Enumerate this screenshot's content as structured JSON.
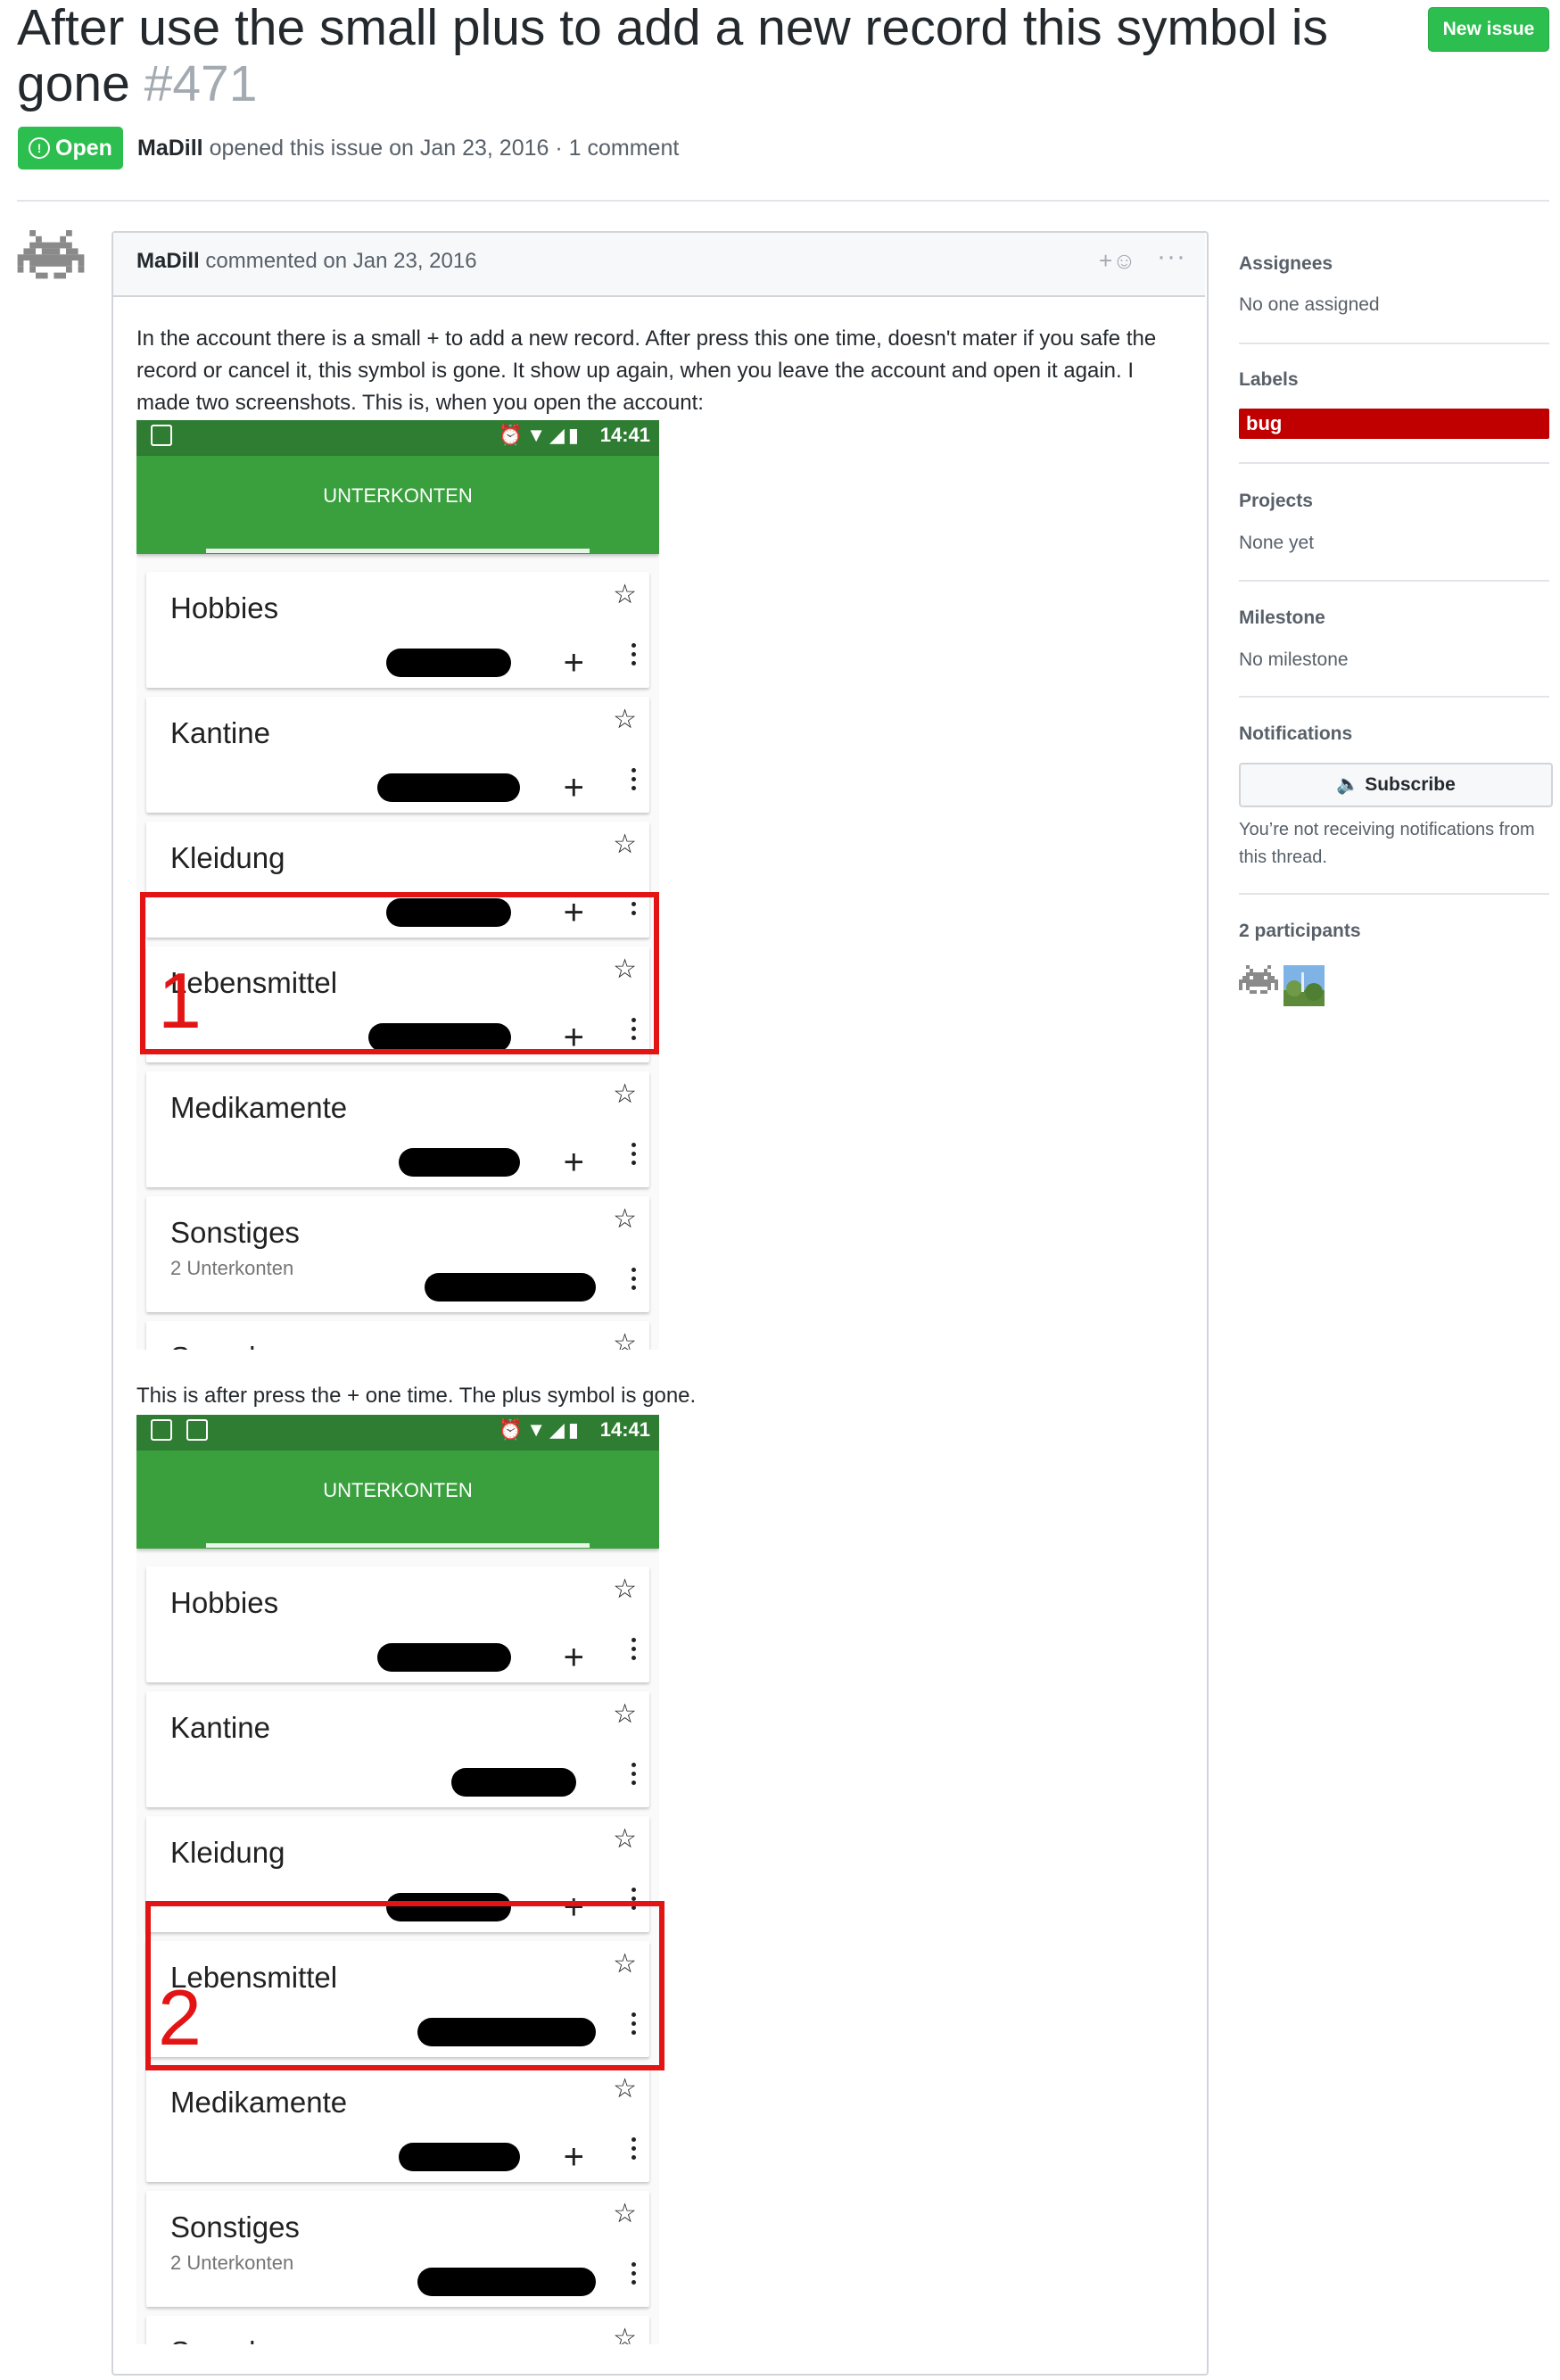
{
  "issue": {
    "title": "After use the small plus to add a new record this symbol is gone",
    "number": "#471",
    "state": "Open",
    "author": "MaDill",
    "opened_text": "opened this issue on Jan 23, 2016 · 1 comment",
    "new_issue_label": "New issue"
  },
  "comment": {
    "author": "MaDill",
    "commented_text": "commented on Jan 23, 2016",
    "react_label": "+☺",
    "more_label": "···",
    "paragraph1": "In the account there is a small + to add a new record. After press this one time, doesn't mater if you safe the record or cancel it, this symbol is gone. It show up again, when you leave the account and open it again. I made two screenshots. This is, when you open the account:",
    "paragraph2": "This is after press the + one time. The plus symbol is gone."
  },
  "screenshots": [
    {
      "time": "14:41",
      "tab_label": "UNTERKONTEN",
      "marker": "1",
      "items": [
        {
          "name": "Hobbies",
          "sub": "",
          "plus": true
        },
        {
          "name": "Kantine",
          "sub": "",
          "plus": true
        },
        {
          "name": "Kleidung",
          "sub": "",
          "plus": true
        },
        {
          "name": "Lebensmittel",
          "sub": "",
          "plus": true
        },
        {
          "name": "Medikamente",
          "sub": "",
          "plus": true
        },
        {
          "name": "Sonstiges",
          "sub": "2 Unterkonten",
          "plus": false
        },
        {
          "name": "Spenden",
          "sub": "",
          "plus": false
        }
      ]
    },
    {
      "time": "14:41",
      "tab_label": "UNTERKONTEN",
      "marker": "2",
      "items": [
        {
          "name": "Hobbies",
          "sub": "",
          "plus": true
        },
        {
          "name": "Kantine",
          "sub": "",
          "plus": false
        },
        {
          "name": "Kleidung",
          "sub": "",
          "plus": true
        },
        {
          "name": "Lebensmittel",
          "sub": "",
          "plus": false
        },
        {
          "name": "Medikamente",
          "sub": "",
          "plus": true
        },
        {
          "name": "Sonstiges",
          "sub": "2 Unterkonten",
          "plus": false
        },
        {
          "name": "Spenden",
          "sub": "",
          "plus": false
        }
      ]
    }
  ],
  "sidebar": {
    "assignees_label": "Assignees",
    "assignees_value": "No one assigned",
    "labels_label": "Labels",
    "label_bug": "bug",
    "label_bug_color": "#c00000",
    "projects_label": "Projects",
    "projects_value": "None yet",
    "milestone_label": "Milestone",
    "milestone_value": "No milestone",
    "notifications_label": "Notifications",
    "subscribe_label": "Subscribe",
    "notifications_text": "You’re not receiving notifications from this thread.",
    "participants_label": "2 participants"
  },
  "colors": {
    "open_green": "#2cbe4e",
    "app_green": "#3aa03e",
    "status_green": "#2f7d32",
    "highlight_red": "#e31414"
  }
}
